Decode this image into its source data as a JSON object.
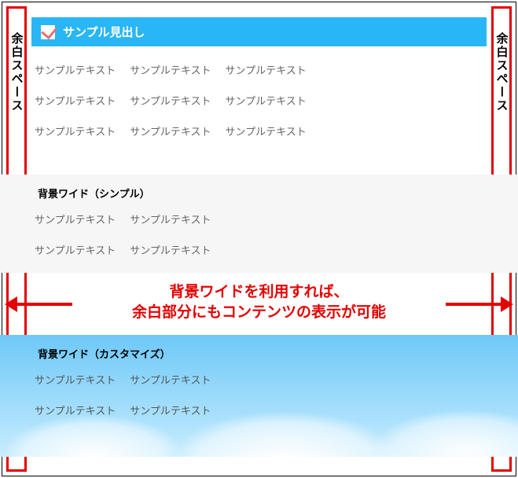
{
  "margin_label": "余白スペース",
  "header": {
    "title": "サンプル見出し"
  },
  "top_section": {
    "rows": [
      [
        "サンプルテキスト",
        "サンプルテキスト",
        "サンプルテキスト"
      ],
      [
        "サンプルテキスト",
        "サンプルテキスト",
        "サンプルテキスト"
      ],
      [
        "サンプルテキスト",
        "サンプルテキスト",
        "サンプルテキスト"
      ]
    ]
  },
  "wide_simple": {
    "title": "背景ワイド（シンプル）",
    "rows": [
      [
        "サンプルテキスト",
        "サンプルテキスト"
      ],
      [
        "サンプルテキスト",
        "サンプルテキスト"
      ]
    ]
  },
  "callout": {
    "line1": "背景ワイドを利用すれば、",
    "line2": "余白部分にもコンテンツの表示が可能"
  },
  "wide_custom": {
    "title": "背景ワイド（カスタマイズ）",
    "rows": [
      [
        "サンプルテキスト",
        "サンプルテキスト"
      ],
      [
        "サンプルテキスト",
        "サンプルテキスト"
      ]
    ]
  }
}
